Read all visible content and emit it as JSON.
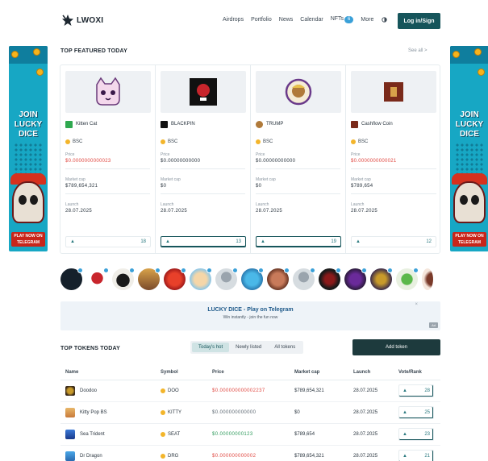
{
  "header": {
    "logo_text": "LWOXI",
    "nav": [
      "Airdrops",
      "Portfolio",
      "News",
      "Calendar",
      "NFTs",
      "More"
    ],
    "nav_badge": "6",
    "signin_label": "Log in/Sign",
    "colors": {
      "primary": "#16555b"
    }
  },
  "side_ad": {
    "title_line1": "JOIN",
    "title_line2": "LUCKY",
    "title_line3": "DICE",
    "cta": "PLAY NOW ON TELEGRAM"
  },
  "featured": {
    "title": "TOP FEATURED TODAY",
    "see_all": "See all >",
    "cards": [
      {
        "name": "Kitten Cat",
        "chain": "BSC",
        "price_label": "Price",
        "price": "$0.0000000000023",
        "mcap_label": "Market cap",
        "mcap": "$789,654,321",
        "launch_label": "Launch",
        "launch": "28.07.2025",
        "votes": "18",
        "img_icon": "kitten-icon"
      },
      {
        "name": "BLACKPIN",
        "chain": "BSC",
        "price_label": "Price",
        "price": "$0.00000000000",
        "mcap_label": "Market cap",
        "mcap": "$0",
        "launch_label": "Launch",
        "launch": "28.07.2025",
        "votes": "13",
        "img_icon": "blackpin-icon"
      },
      {
        "name": "TRUMP",
        "chain": "BSC",
        "price_label": "Price",
        "price": "$0.00000000000",
        "mcap_label": "Market cap",
        "mcap": "$0",
        "launch_label": "Launch",
        "launch": "28.07.2025",
        "votes": "19",
        "img_icon": "trump-icon"
      },
      {
        "name": "Cashflow Coin",
        "chain": "BSC",
        "price_label": "Price",
        "price": "$0.0000000000021",
        "mcap_label": "Market cap",
        "mcap": "$789,654",
        "launch_label": "Launch",
        "launch": "28.07.2025",
        "votes": "12",
        "img_icon": "cashflow-icon"
      }
    ]
  },
  "banner": {
    "title": "LUCKY DICE - Play on Telegram",
    "subtitle": "Win instantly - join the fun now",
    "tag": "Ad",
    "close": "×"
  },
  "tokens": {
    "title": "TOP TOKENS TODAY",
    "tabs": [
      "Today's hot",
      "Newly listed",
      "All tokens"
    ],
    "add_label": "Add token",
    "columns": [
      "Name",
      "Symbol",
      "Price",
      "Market cap",
      "Launch",
      "Vote/Rank"
    ],
    "rows": [
      {
        "name": "Doodoo",
        "symbol": "DOO",
        "price": "$0.000000000002237",
        "price_color": "red",
        "mcap": "$789,654,321",
        "launch": "28.07.2025",
        "votes": "28"
      },
      {
        "name": "Kitty Pop BS",
        "symbol": "KITTY",
        "price": "$0.000000000000",
        "price_color": "gray",
        "mcap": "$0",
        "launch": "28.07.2025",
        "votes": "25"
      },
      {
        "name": "Sea Trident",
        "symbol": "SEAT",
        "price": "$0.00000000123",
        "price_color": "green",
        "mcap": "$789,654",
        "launch": "28.07.2025",
        "votes": "23"
      },
      {
        "name": "Dr Dragon",
        "symbol": "DRG",
        "price": "$0.000000000002",
        "price_color": "red",
        "mcap": "$789,654,321",
        "launch": "28.07.2025",
        "votes": "21"
      }
    ]
  }
}
